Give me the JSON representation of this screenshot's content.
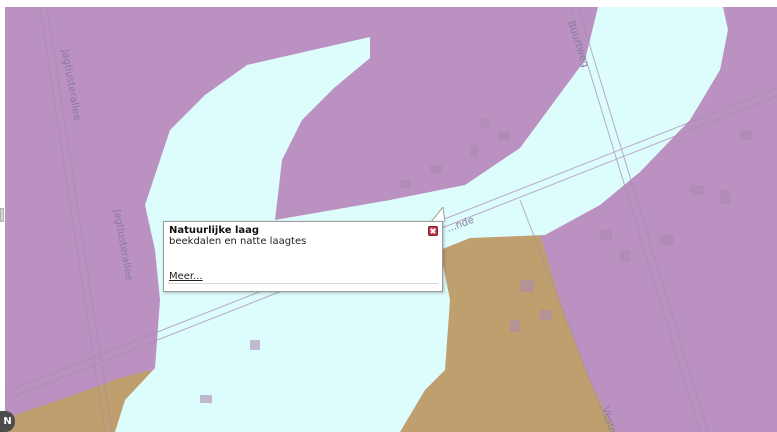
{
  "map": {
    "colors": {
      "frame": "#ffffff",
      "purple_zone": "#bb91c1",
      "river_zone": "#ddfcfc",
      "brown_zone": "#bf9f6d",
      "building": "#ad8ab0",
      "road_line": "#a98ab0"
    },
    "road_labels": [
      "Jagtlusterallee",
      "Jagtlusterallee",
      "Buurtweg",
      "...nde",
      "Veste..."
    ]
  },
  "popup": {
    "title": "Natuurlijke laag",
    "description": "beekdalen en natte laagtes",
    "link_label": "Meer...",
    "close_icon": "close-icon"
  },
  "controls": {
    "north_label": "N"
  }
}
